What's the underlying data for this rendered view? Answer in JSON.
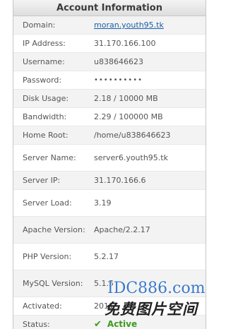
{
  "panel": {
    "title": "Account Information"
  },
  "rows": [
    {
      "label": "Domain:",
      "value": "moran.youth95.tk"
    },
    {
      "label": "IP Address:",
      "value": "31.170.166.100"
    },
    {
      "label": "Username:",
      "value": "u838646623"
    },
    {
      "label": "Password:",
      "value": "••••••••••"
    },
    {
      "label": "Disk Usage:",
      "value": "2.18 / 10000 MB"
    },
    {
      "label": "Bandwidth:",
      "value": "2.29 / 100000 MB"
    },
    {
      "label": "Home Root:",
      "value": "/home/u838646623"
    },
    {
      "label": "Server Name:",
      "value": "server6.youth95.tk"
    },
    {
      "label": "Server IP:",
      "value": "31.170.166.6"
    },
    {
      "label": "Server Load:",
      "value": "3.19"
    },
    {
      "label": "Apache Version:",
      "value": "Apache/2.2.17"
    },
    {
      "label": "PHP Version:",
      "value": "5.2.17"
    },
    {
      "label": "MySQL Version:",
      "value": "5.1.5"
    },
    {
      "label": "Activated:",
      "value": "2011-"
    },
    {
      "label": "Status:",
      "value": "Active"
    }
  ],
  "status": {
    "icon": "check-icon",
    "color": "#3c9a1e"
  },
  "link_color": "#1a5fa6",
  "watermark": {
    "line1": "IDC886.com",
    "line2": "免费图片空间"
  }
}
